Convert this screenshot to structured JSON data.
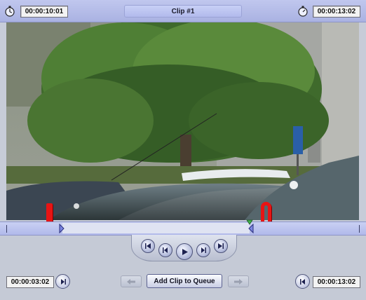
{
  "header": {
    "current_time": "00:00:10:01",
    "clip_title": "Clip #1",
    "duration": "00:00:13:02"
  },
  "icons": {
    "left_stopwatch": "stopwatch-icon",
    "right_stopwatch": "stopwatch-icon",
    "in_marker_flag": "in-point-marker-icon",
    "out_marker_flag": "out-point-marker-icon",
    "playhead": "playhead-icon"
  },
  "timeline": {
    "in_fraction": 0.155,
    "out_fraction": 0.69,
    "playhead_fraction": 0.69
  },
  "transport": {
    "buttons": [
      "go-to-start",
      "step-back",
      "play",
      "step-forward",
      "go-to-end"
    ]
  },
  "footer": {
    "in_point": "00:00:03:02",
    "add_clip_label": "Add Clip to Queue",
    "out_point": "00:00:13:02"
  },
  "colors": {
    "accent_blue": "#aab2e2",
    "marker_red": "#e81414",
    "playhead_green": "#3fb24b"
  }
}
